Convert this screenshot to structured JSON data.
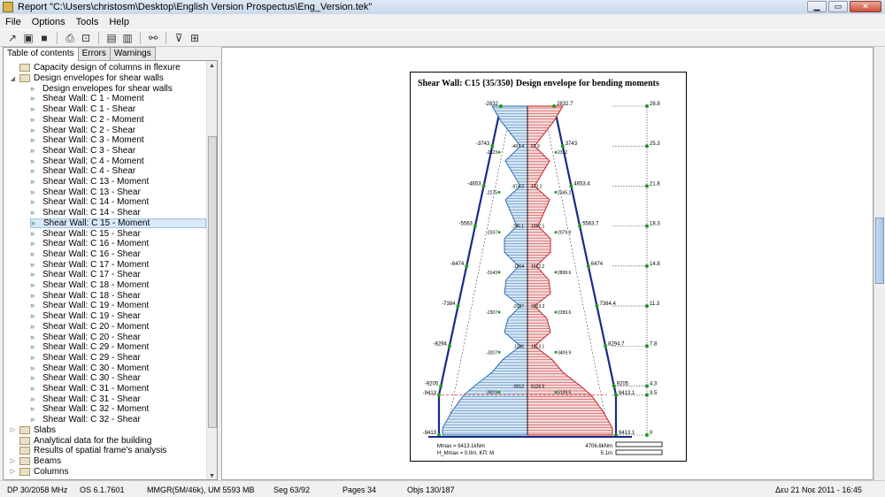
{
  "window": {
    "title": "Report \"C:\\Users\\christosm\\Desktop\\English Version Prospectus\\Eng_Version.tek\""
  },
  "menu": [
    "File",
    "Options",
    "Tools",
    "Help"
  ],
  "tabs": [
    "Table of contents",
    "Errors",
    "Warnings"
  ],
  "tree": [
    {
      "label": "Capacity design of columns in flexure",
      "type": "folder",
      "level": 1
    },
    {
      "label": "Design envelopes for shear walls",
      "type": "folder-open",
      "level": 0
    },
    {
      "label": "Design envelopes for shear walls",
      "type": "page",
      "level": 2
    },
    {
      "label": "Shear Wall: C 1 - Moment",
      "type": "page",
      "level": 2
    },
    {
      "label": "Shear Wall: C 1 - Shear",
      "type": "page",
      "level": 2
    },
    {
      "label": "Shear Wall: C 2 - Moment",
      "type": "page",
      "level": 2
    },
    {
      "label": "Shear Wall: C 2 - Shear",
      "type": "page",
      "level": 2
    },
    {
      "label": "Shear Wall: C 3 - Moment",
      "type": "page",
      "level": 2
    },
    {
      "label": "Shear Wall: C 3 - Shear",
      "type": "page",
      "level": 2
    },
    {
      "label": "Shear Wall: C 4 - Moment",
      "type": "page",
      "level": 2
    },
    {
      "label": "Shear Wall: C 4 - Shear",
      "type": "page",
      "level": 2
    },
    {
      "label": "Shear Wall: C 13 - Moment",
      "type": "page",
      "level": 2
    },
    {
      "label": "Shear Wall: C 13 - Shear",
      "type": "page",
      "level": 2
    },
    {
      "label": "Shear Wall: C 14 - Moment",
      "type": "page",
      "level": 2
    },
    {
      "label": "Shear Wall: C 14 - Shear",
      "type": "page",
      "level": 2
    },
    {
      "label": "Shear Wall: C 15 - Moment",
      "type": "page",
      "level": 2,
      "selected": true
    },
    {
      "label": "Shear Wall: C 15 - Shear",
      "type": "page",
      "level": 2
    },
    {
      "label": "Shear Wall: C 16 - Moment",
      "type": "page",
      "level": 2
    },
    {
      "label": "Shear Wall: C 16 - Shear",
      "type": "page",
      "level": 2
    },
    {
      "label": "Shear Wall: C 17 - Moment",
      "type": "page",
      "level": 2
    },
    {
      "label": "Shear Wall: C 17 - Shear",
      "type": "page",
      "level": 2
    },
    {
      "label": "Shear Wall: C 18 - Moment",
      "type": "page",
      "level": 2
    },
    {
      "label": "Shear Wall: C 18 - Shear",
      "type": "page",
      "level": 2
    },
    {
      "label": "Shear Wall: C 19 - Moment",
      "type": "page",
      "level": 2
    },
    {
      "label": "Shear Wall: C 19 - Shear",
      "type": "page",
      "level": 2
    },
    {
      "label": "Shear Wall: C 20 - Moment",
      "type": "page",
      "level": 2
    },
    {
      "label": "Shear Wall: C 20 - Shear",
      "type": "page",
      "level": 2
    },
    {
      "label": "Shear Wall: C 29 - Moment",
      "type": "page",
      "level": 2
    },
    {
      "label": "Shear Wall: C 29 - Shear",
      "type": "page",
      "level": 2
    },
    {
      "label": "Shear Wall: C 30 - Moment",
      "type": "page",
      "level": 2
    },
    {
      "label": "Shear Wall: C 30 - Shear",
      "type": "page",
      "level": 2
    },
    {
      "label": "Shear Wall: C 31 - Moment",
      "type": "page",
      "level": 2
    },
    {
      "label": "Shear Wall: C 31 - Shear",
      "type": "page",
      "level": 2
    },
    {
      "label": "Shear Wall: C 32 - Moment",
      "type": "page",
      "level": 2
    },
    {
      "label": "Shear Wall: C 32 - Shear",
      "type": "page",
      "level": 2
    },
    {
      "label": "Slabs",
      "type": "folder",
      "level": 0
    },
    {
      "label": "Analytical data for the building",
      "type": "folder",
      "level": 1
    },
    {
      "label": "Results of spatial frame's analysis",
      "type": "folder",
      "level": 1
    },
    {
      "label": "Beams",
      "type": "folder",
      "level": 0
    },
    {
      "label": "Columns",
      "type": "folder",
      "level": 0
    }
  ],
  "report": {
    "title": "Shear Wall: C15 {35/350} Design envelope for bending moments",
    "footer": {
      "mmax": "Mmax = 9413.1kNm",
      "h_mmax": "H_Mmax = 0.0m, ΚΠ: M",
      "scale_moment": "4706.6kNm",
      "scale_length": "5.1m"
    }
  },
  "chart_data": {
    "type": "bar",
    "levels": [
      28.8,
      25.3,
      21.8,
      18.3,
      14.8,
      11.3,
      7.8,
      4.3,
      3.5,
      0
    ],
    "envelope_left": [
      "-2832",
      "-3743",
      "-4653",
      "-5563",
      "-6474",
      "-7384",
      "-8294",
      "-9205",
      "-9413",
      "-9413"
    ],
    "envelope_right": [
      "2832.7",
      "3743",
      "4653.4",
      "5563.7",
      "6474",
      "7384.4",
      "8294.7",
      "9205",
      "9413.1",
      "9413.1"
    ],
    "inner_left_labels": [
      "-497.4",
      "-974.3",
      "-796.1",
      "-1264",
      "-2037",
      "-1186",
      "-9013"
    ],
    "inner_right_labels": [
      "67.9",
      "473.2",
      "1067.1",
      "1512.2",
      "2263.3",
      "1013.1",
      "6126.5"
    ],
    "outer_left_labels": [
      "-2323",
      "-2275",
      "-2337",
      "-3143",
      "-2307",
      "-3207",
      "-9019"
    ],
    "outer_right_labels": [
      "2312",
      "2345.2",
      "2079.3",
      "2898.6",
      "2289.6",
      "3409.9",
      "5139.5"
    ],
    "level_labels": [
      "28.8",
      "25.3",
      "21.8",
      "18.3",
      "14.8",
      "11.3",
      "7.8",
      "4.3",
      "3.5",
      "0"
    ]
  },
  "status": {
    "dp": "DP 30/2058 MHz",
    "os": "OS 6.1.7601",
    "mmgr": "MMGR(5M/46k), UM 5593 MB",
    "seg": "Seg 63/92",
    "pages": "Pages 34",
    "objs": "Objs 130/187",
    "date": "Δευ 21 Νοε 2011 - 16:45"
  }
}
